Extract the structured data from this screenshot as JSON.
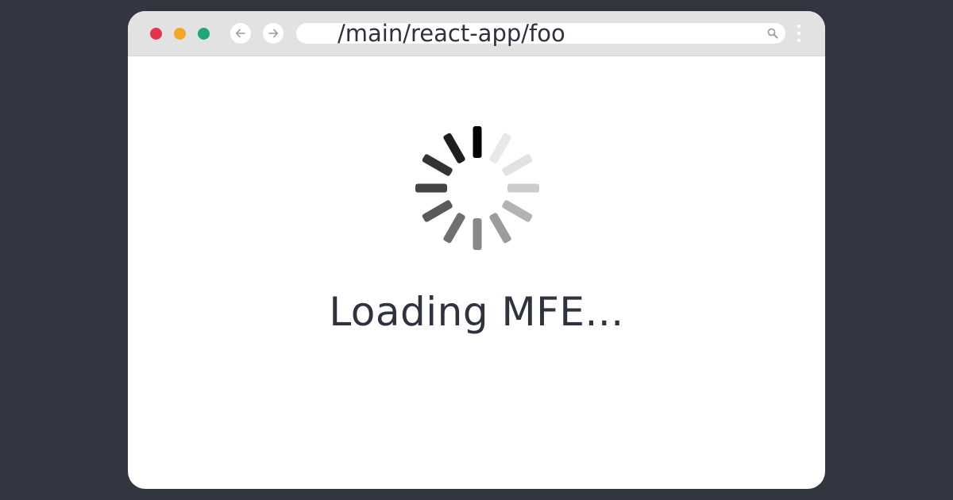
{
  "browser": {
    "url": "/main/react-app/foo",
    "traffic_lights": {
      "close_color": "#e5334b",
      "minimize_color": "#f5a623",
      "maximize_color": "#21a67a"
    },
    "back_icon": "arrow-left-icon",
    "forward_icon": "arrow-right-icon",
    "search_icon": "search-icon",
    "menu_icon": "kebab-menu-icon"
  },
  "main": {
    "loading_text": "Loading MFE...",
    "spinner_icon": "loading-spinner-icon",
    "spinner_colors": [
      "#000000",
      "#e8e8e8",
      "#e2e2e2",
      "#cccccc",
      "#b3b3b3",
      "#9c9c9c",
      "#878787",
      "#6f6f6f",
      "#5a5a5a",
      "#454545",
      "#333333",
      "#1f1f1f"
    ]
  },
  "colors": {
    "background": "#323640",
    "window": "#ffffff",
    "titlebar": "#e2e2e2",
    "text": "#2f333d"
  }
}
